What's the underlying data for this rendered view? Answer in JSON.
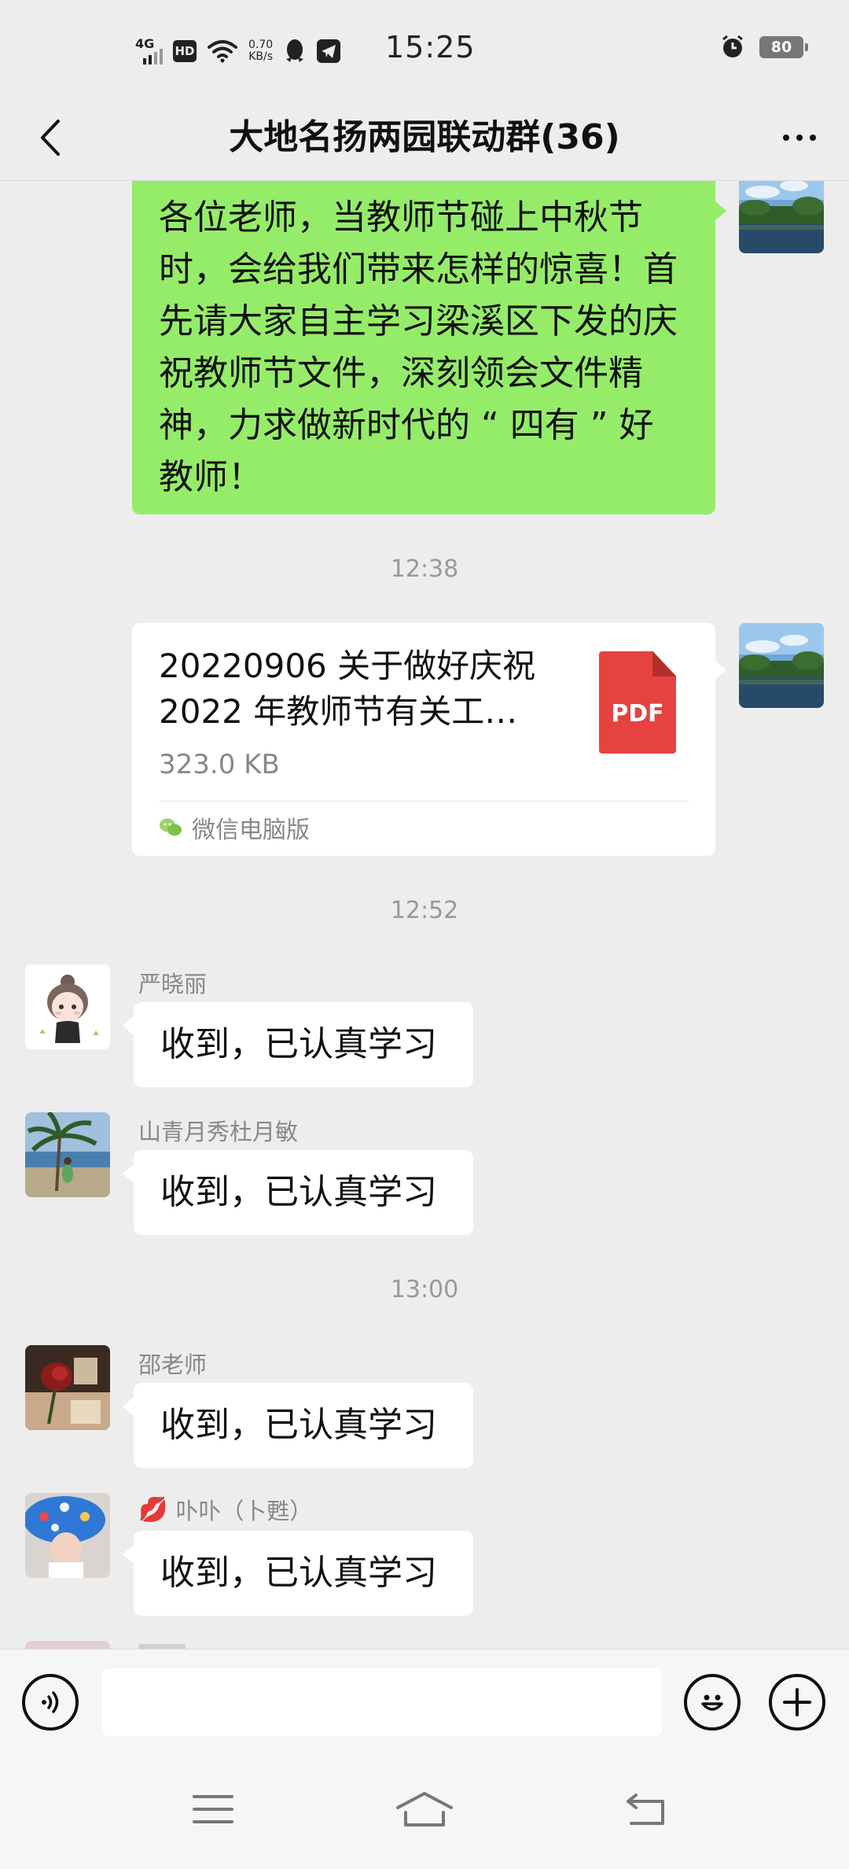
{
  "status_bar": {
    "network": "4G",
    "hd": "HD",
    "speed_value": "0.70",
    "speed_unit": "KB/s",
    "time": "15:25",
    "battery": "80"
  },
  "header": {
    "title": "大地名扬两园联动群(36)"
  },
  "messages": {
    "m1": {
      "lines": [
        "各位老师，当教师节碰上中秋节",
        "时，会给我们带来怎样的惊喜！首",
        "先请大家自主学习梁溪区下发的庆",
        "祝教师节文件，深刻领会文件精",
        "神，力求做新时代的 “ 四有 ” 好",
        "教师！"
      ]
    },
    "ts1": "12:38",
    "file": {
      "title_line1": "20220906 关于做好庆祝",
      "title_line2": "2022 年教师节有关工…",
      "size": "323.0 KB",
      "type_label": "PDF",
      "source": "微信电脑版"
    },
    "ts2": "12:52",
    "m2": {
      "sender": "严晓丽",
      "text": "收到，已认真学习"
    },
    "m3": {
      "sender": "山青月秀杜月敏",
      "text": "收到，已认真学习"
    },
    "ts3": "13:00",
    "m4": {
      "sender": "邵老师",
      "text": "收到，已认真学习"
    },
    "m5": {
      "sender_emoji": "💋",
      "sender": "卟卟（卜甦）",
      "text": "收到，已认真学习"
    }
  },
  "input": {
    "placeholder": ""
  },
  "icons": {
    "back": "back-arrow-icon",
    "more": "more-dots-icon",
    "voice": "voice-icon",
    "emoji": "emoji-icon",
    "add": "plus-icon",
    "nav_menu": "menu-icon",
    "nav_home": "home-icon",
    "nav_back": "back-icon"
  },
  "colors": {
    "background": "#ededed",
    "own_bubble": "#95ec69",
    "other_bubble": "#ffffff",
    "pdf": "#e64340"
  }
}
